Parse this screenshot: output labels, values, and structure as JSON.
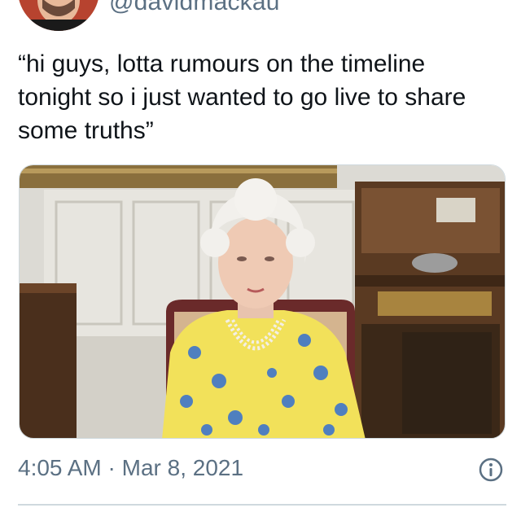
{
  "tweet": {
    "author_handle": "@davidmackau",
    "text_lines": [
      "“hi guys, lotta rumours on the timeline",
      "tonight so i just wanted to go live to share",
      "some truths”"
    ],
    "time": "4:05 AM",
    "separator": "·",
    "date": "Mar 8, 2021",
    "info_icon": "info-circle-icon"
  },
  "colors": {
    "text_primary": "#0f1419",
    "text_secondary": "#5b7083",
    "divider": "#cfd9de"
  }
}
